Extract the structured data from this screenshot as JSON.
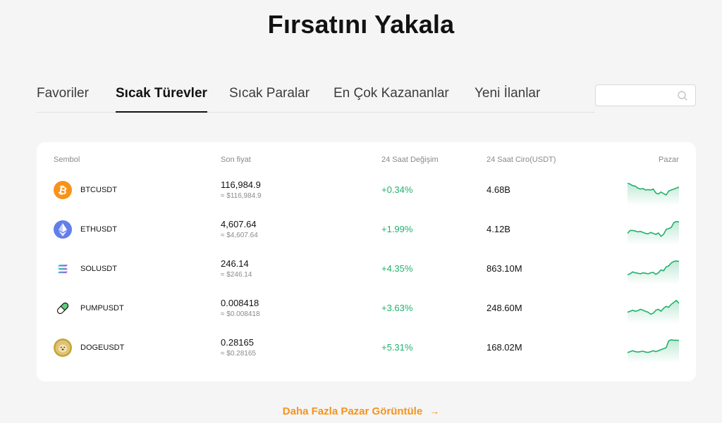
{
  "page": {
    "title": "Fırsatını Yakala"
  },
  "tabs": [
    {
      "label": "Favoriler",
      "active": false
    },
    {
      "label": "Sıcak Türevler",
      "active": true
    },
    {
      "label": "Sıcak Paralar",
      "active": false
    },
    {
      "label": "En Çok Kazananlar",
      "active": false
    },
    {
      "label": "Yeni İlanlar",
      "active": false
    }
  ],
  "search": {
    "value": "",
    "placeholder": "",
    "icon": "search-icon"
  },
  "table": {
    "headers": {
      "symbol": "Sembol",
      "price": "Son fiyat",
      "change": "24 Saat Değişim",
      "volume": "24 Saat Ciro(USDT)",
      "market": "Pazar"
    },
    "rows": [
      {
        "icon": "bitcoin-icon",
        "symbol": "BTCUSDT",
        "price": "116,984.9",
        "price_usd": "≈ $116,984.9",
        "change": "+0.34%",
        "volume": "4.68B",
        "spark": [
          0.85,
          0.8,
          0.72,
          0.7,
          0.6,
          0.55,
          0.58,
          0.5,
          0.52,
          0.5,
          0.55,
          0.35,
          0.3,
          0.4,
          0.32,
          0.25,
          0.45,
          0.5,
          0.55,
          0.6,
          0.65
        ]
      },
      {
        "icon": "ethereum-icon",
        "symbol": "ETHUSDT",
        "price": "4,607.64",
        "price_usd": "≈ $4,607.64",
        "change": "+1.99%",
        "volume": "4.12B",
        "spark": [
          0.3,
          0.45,
          0.45,
          0.42,
          0.38,
          0.4,
          0.35,
          0.3,
          0.28,
          0.35,
          0.3,
          0.25,
          0.32,
          0.15,
          0.25,
          0.5,
          0.55,
          0.6,
          0.85,
          0.9,
          0.88
        ]
      },
      {
        "icon": "solana-icon",
        "symbol": "SOLUSDT",
        "price": "246.14",
        "price_usd": "≈ $246.14",
        "change": "+4.35%",
        "volume": "863.10M",
        "spark": [
          0.2,
          0.25,
          0.35,
          0.3,
          0.28,
          0.25,
          0.3,
          0.28,
          0.25,
          0.3,
          0.32,
          0.22,
          0.3,
          0.45,
          0.4,
          0.6,
          0.65,
          0.8,
          0.88,
          0.9,
          0.88
        ]
      },
      {
        "icon": "pill-icon",
        "symbol": "PUMPUSDT",
        "price": "0.008418",
        "price_usd": "≈ $0.008418",
        "change": "+3.63%",
        "volume": "248.60M",
        "spark": [
          0.3,
          0.35,
          0.4,
          0.35,
          0.38,
          0.45,
          0.4,
          0.35,
          0.3,
          0.2,
          0.25,
          0.4,
          0.45,
          0.35,
          0.5,
          0.6,
          0.55,
          0.7,
          0.8,
          0.9,
          0.75
        ]
      },
      {
        "icon": "dogecoin-icon",
        "symbol": "DOGEUSDT",
        "price": "0.28165",
        "price_usd": "≈ $0.28165",
        "change": "+5.31%",
        "volume": "168.02M",
        "spark": [
          0.25,
          0.3,
          0.35,
          0.3,
          0.28,
          0.3,
          0.32,
          0.28,
          0.26,
          0.3,
          0.35,
          0.3,
          0.35,
          0.4,
          0.45,
          0.5,
          0.85,
          0.9,
          0.88,
          0.88,
          0.87
        ]
      }
    ]
  },
  "more": {
    "label": "Daha Fazla Pazar Görüntüle",
    "arrow": "→"
  },
  "colors": {
    "up": "#20b26c",
    "accent": "#f7931a",
    "btc": "#f7931a",
    "eth": "#627eea",
    "doge": "#c2a633"
  }
}
